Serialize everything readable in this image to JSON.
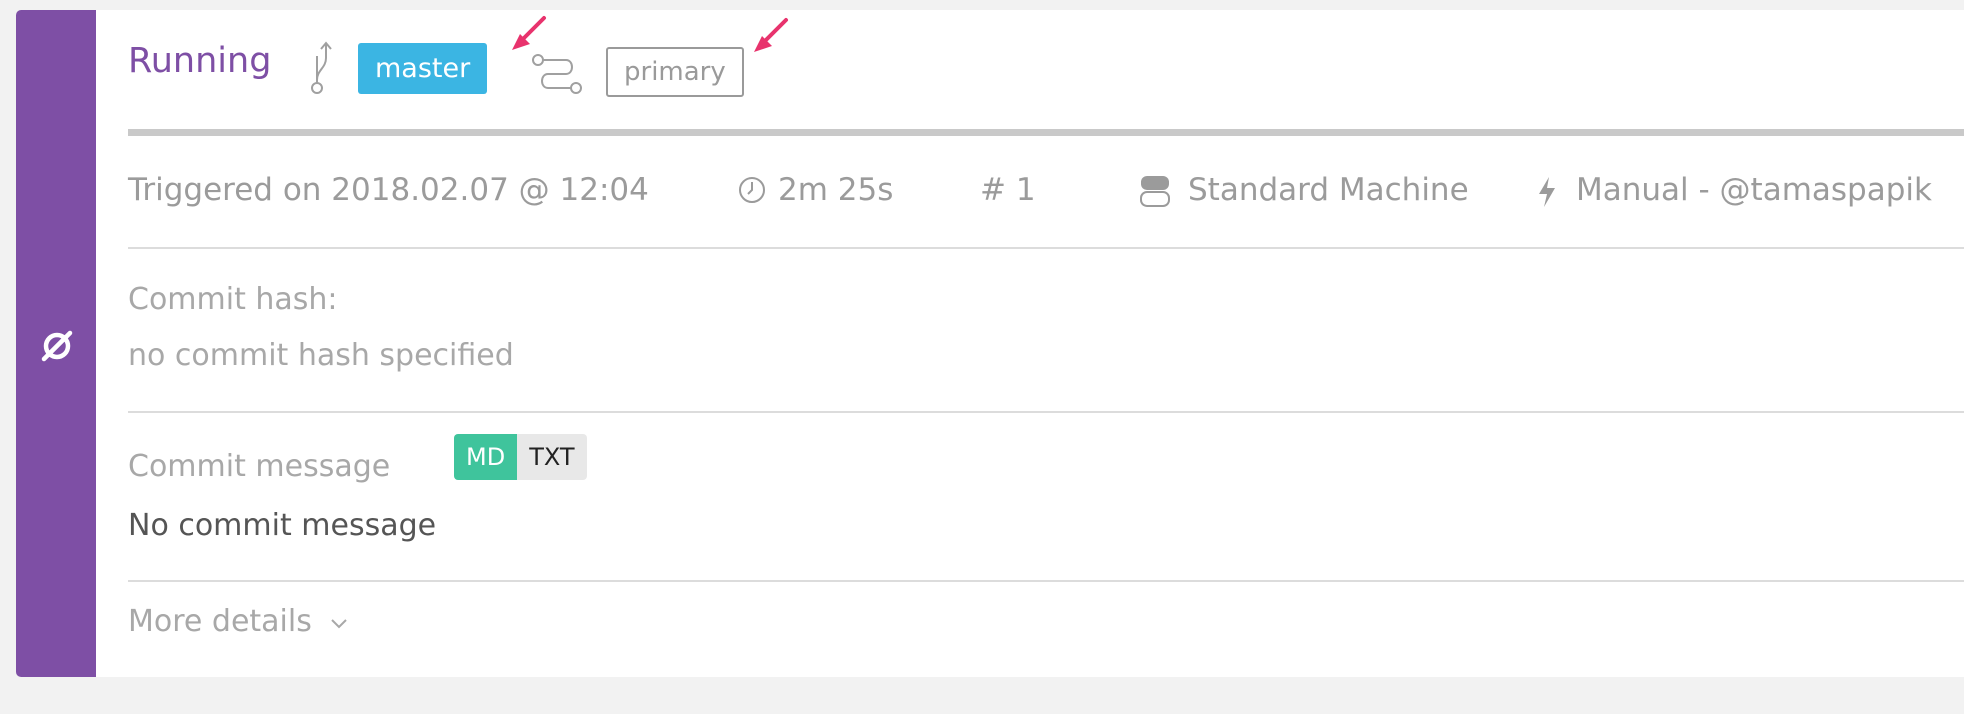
{
  "build": {
    "status_label": "Running",
    "branch": "master",
    "workflow": "primary",
    "progress_fraction": 1.0
  },
  "meta": {
    "triggered": "Triggered on 2018.02.07 @ 12:04",
    "duration": "2m 25s",
    "build_number": "# 1",
    "machine": "Standard Machine",
    "trigger": "Manual - @tamaspapik"
  },
  "commit_hash": {
    "label": "Commit hash:",
    "value": "no commit hash specified"
  },
  "commit_message": {
    "label": "Commit message",
    "format_md": "MD",
    "format_txt": "TXT",
    "value": "No commit message"
  },
  "more_details_label": "More details",
  "icons": {
    "status": "aborted-circle-slash-icon",
    "branch": "branch-icon",
    "workflow": "workflow-icon",
    "duration": "clock-icon",
    "machine": "stack-icon",
    "trigger": "lightning-icon",
    "more": "chevron-down-icon",
    "annotation": "arrow-icon"
  },
  "colors": {
    "status_purple": "#7e4fa5",
    "branch_blue": "#3bb5e3",
    "md_green": "#3fc49c",
    "annotation_pink": "#e8336d"
  }
}
